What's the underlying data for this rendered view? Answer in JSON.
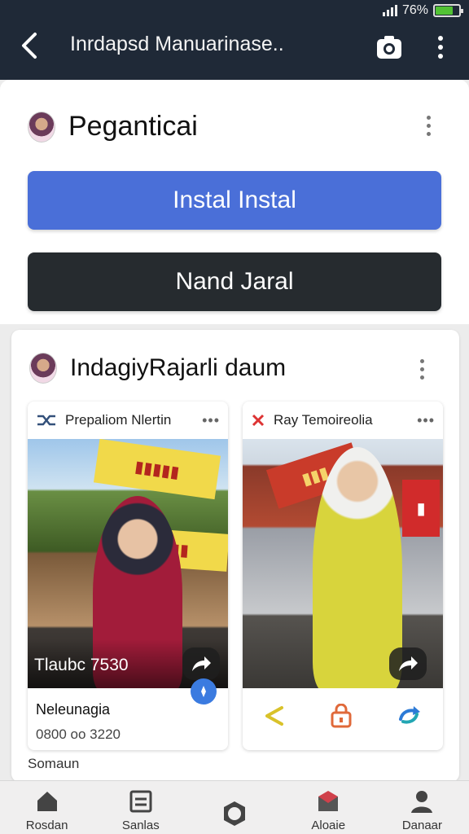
{
  "status_bar": {
    "battery_text": "76%",
    "battery_level": 0.76,
    "battery_color": "#52c234"
  },
  "app_bar": {
    "title": "Inrdapsd Manuarinase..",
    "back_icon": "back-chevron-icon",
    "camera_icon": "camera-icon",
    "menu_icon": "more-vertical-icon"
  },
  "profile": {
    "name": "Peganticai"
  },
  "buttons": {
    "primary_label": "Instal Instal",
    "secondary_label": "Nand Jaral",
    "primary_color": "#4a6fd8",
    "secondary_color": "#262b2f"
  },
  "feed": {
    "title": "IndagiyRajarli daum",
    "posts": [
      {
        "header": "Prepaliom Nlertin",
        "caption": "Tlaubc 7530",
        "user": "Neleunagia",
        "stats": "0800 oo 3220"
      },
      {
        "header": "Ray Temoireolia"
      }
    ]
  },
  "section_label": "Somaun",
  "bottom_nav": [
    {
      "label": "Rosdan",
      "icon": "home-icon"
    },
    {
      "label": "Sanlas",
      "icon": "list-icon"
    },
    {
      "label": "",
      "icon": "hexagon-icon"
    },
    {
      "label": "Aloaie",
      "icon": "mail-icon"
    },
    {
      "label": "Danaar",
      "icon": "person-icon"
    }
  ]
}
